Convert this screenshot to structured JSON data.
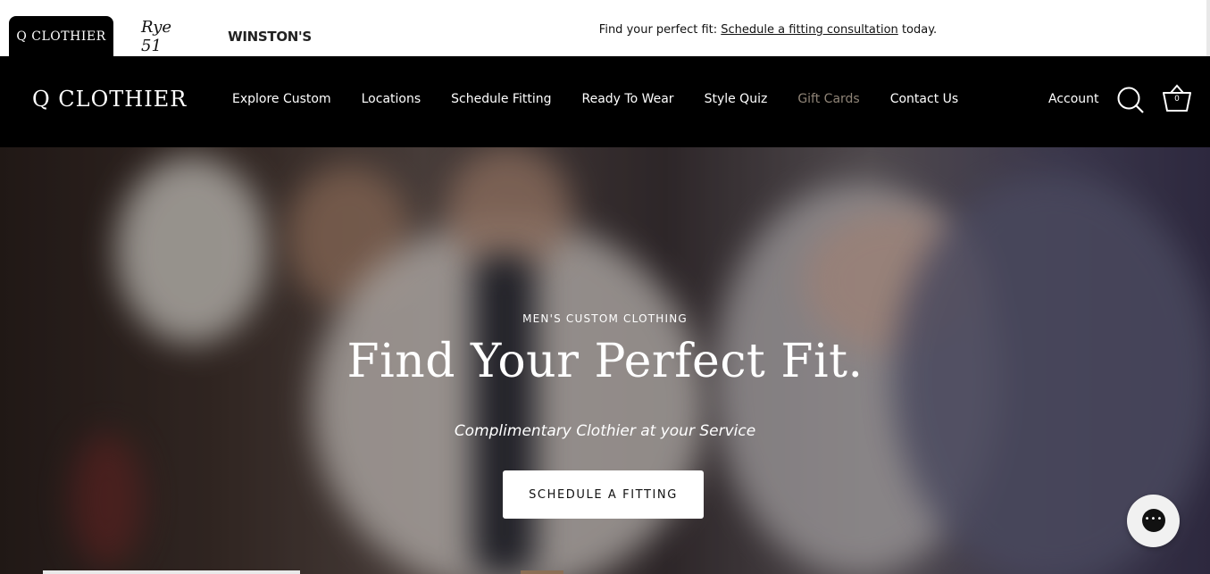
{
  "brands": {
    "q_clothier": "Q CLOTHIER",
    "rye51": "Rye 51",
    "winstons": "WINSTON'S"
  },
  "promo": {
    "prefix": "Find your perfect fit: ",
    "link": "Schedule a fitting consultation",
    "suffix": " today."
  },
  "nav": {
    "logo": "Q CLOTHIER",
    "items": [
      {
        "label": "Explore Custom"
      },
      {
        "label": "Locations"
      },
      {
        "label": "Schedule Fitting"
      },
      {
        "label": "Ready To Wear"
      },
      {
        "label": "Style Quiz"
      },
      {
        "label": "Gift Cards"
      },
      {
        "label": "Contact Us"
      }
    ],
    "account": "Account",
    "cart_count": "0"
  },
  "hero": {
    "eyebrow": "MEN'S CUSTOM CLOTHING",
    "headline": "Find Your Perfect Fit.",
    "subhead": "Complimentary Clothier at your Service",
    "cta": "SCHEDULE A FITTING"
  },
  "colors": {
    "nav_bg": "#000000",
    "muted_link": "#8f8477",
    "button_bg": "#ffffff"
  },
  "icons": [
    "search-icon",
    "cart-icon",
    "chat-icon"
  ]
}
